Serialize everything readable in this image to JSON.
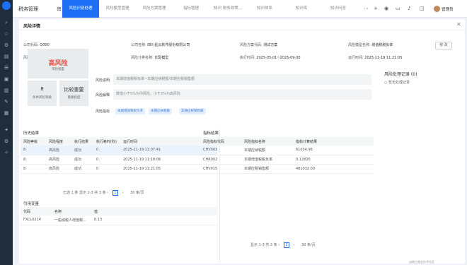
{
  "app": {
    "name": "税务管理"
  },
  "tabs": [
    {
      "label": "风险识别处理",
      "active": true
    },
    {
      "label": "风险模型管理",
      "active": false
    },
    {
      "label": "风险方案管理",
      "active": false
    },
    {
      "label": "指标管理",
      "active": false
    },
    {
      "label": "知识 税务政策...",
      "active": false
    },
    {
      "label": "知识体系",
      "active": false
    },
    {
      "label": "知识库",
      "active": false
    },
    {
      "label": "知识问答",
      "active": false
    }
  ],
  "user": {
    "name": "管理员"
  },
  "panel": {
    "title": "风险详情",
    "edit_label": "修 改"
  },
  "info": {
    "company_code_label": "公司代码:",
    "company_code": "Q000",
    "company_name_label": "公司名称:",
    "company_name": "四川星云软件股份有限公司",
    "plan_code_label": "风险方案代码:",
    "plan_code": "测试方案",
    "model_name_label": "风险模型名称:",
    "model_name": "增值税税负率",
    "nature_label": "风险性质:",
    "nature": "预警",
    "category_label": "风险分类名称:",
    "category": "长配模型",
    "exec_time_label": "执行时间:",
    "exec_time": "2025-05-01~2025-09-30",
    "run_time_label": "运行时间:",
    "run_time": "2025-11-19 11:21:05"
  },
  "risk": {
    "level": "高风险",
    "level_sub": "风险程度",
    "count": "8",
    "count_label": "条件风险等级",
    "importance": "比较重要",
    "importance_label": "重要程度"
  },
  "fields": {
    "desc_label": "风险说明",
    "desc": "本期增值税税负率~本期应纳税额/本期应税销售额",
    "rule_label": "风险解释",
    "rule": "数值小于5%为中风险，小于3%为高风险",
    "indicator_label": "风险指标",
    "indicator_tags": [
      "本期增值税税负率",
      "本期应纳税额",
      "本期应税销售额"
    ]
  },
  "handle": {
    "title": "风险处理记录 (0)",
    "empty": "暂无处理记录"
  },
  "history": {
    "title": "历史结果",
    "headers": [
      "风险等级",
      "风险程度",
      "执行结果",
      "执行耗时(秒)",
      "运行时间"
    ],
    "rows": [
      [
        "8",
        "高风险",
        "成功",
        "0",
        "2025-11-19 11:07:41"
      ],
      [
        "8",
        "高风险",
        "成功",
        "0",
        "2025-11-19 11:18:08"
      ],
      [
        "8",
        "高风险",
        "成功",
        "0",
        "2025-11-19 11:21:05"
      ]
    ],
    "pager": "已选 1 条  显示 1-3 共 3 条",
    "page": "1",
    "page_size": "30 条/页"
  },
  "indicator": {
    "title": "指标结果",
    "headers": [
      "风险指标代码",
      "风险指标名称",
      "指标计算结果"
    ],
    "rows": [
      [
        "CHV003",
        "本期应纳税额",
        "61034.96"
      ],
      [
        "CHR002",
        "本期增值税税负率",
        "0.12826"
      ],
      [
        "CHV015",
        "本期应税销售额",
        "481032.00"
      ]
    ],
    "pager": "显示 1-3 共 3 条",
    "page": "1",
    "page_size": "30 条/页"
  },
  "ref": {
    "title": "引用变量",
    "headers": [
      "代码",
      "名称",
      "值"
    ],
    "rows": [
      [
        "FXCL0214",
        "一般纳税人增值税...",
        "0.13"
      ]
    ]
  },
  "footer": "@稀土掘金技术社区"
}
